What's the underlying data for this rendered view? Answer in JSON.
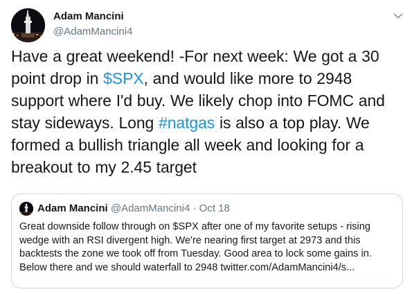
{
  "tweet": {
    "author": {
      "name": "Adam Mancini",
      "handle": "@AdamMancini4",
      "avatar_icon": "avatar-city-tower-icon"
    },
    "menu_icon": "chevron-down-icon",
    "text_parts": [
      "Have a great weekend! -For next week: We got a 30 point drop in ",
      "$SPX",
      ", and would like more to 2948 support where I'd buy. We likely chop into FOMC and stay sideways. Long ",
      "#natgas",
      " is also a top play. We formed a bullish triangle all week and looking for a breakout to my 2.45 target"
    ],
    "link_color": "#1b95e0"
  },
  "quoted_tweet": {
    "author": {
      "name": "Adam Mancini",
      "handle": "@AdamMancini4",
      "avatar_icon": "avatar-city-tower-icon"
    },
    "separator": "·",
    "date": "Oct 18",
    "text": "Great downside follow through on $SPX after one of my favorite setups - rising wedge with an RSI divergent high.  We're nearing first target at 2973 and this backtests the zone we took off from Tuesday. Good area to lock some gains in. Below there and we should waterfall to 2948 twitter.com/AdamMancini4/s..."
  }
}
